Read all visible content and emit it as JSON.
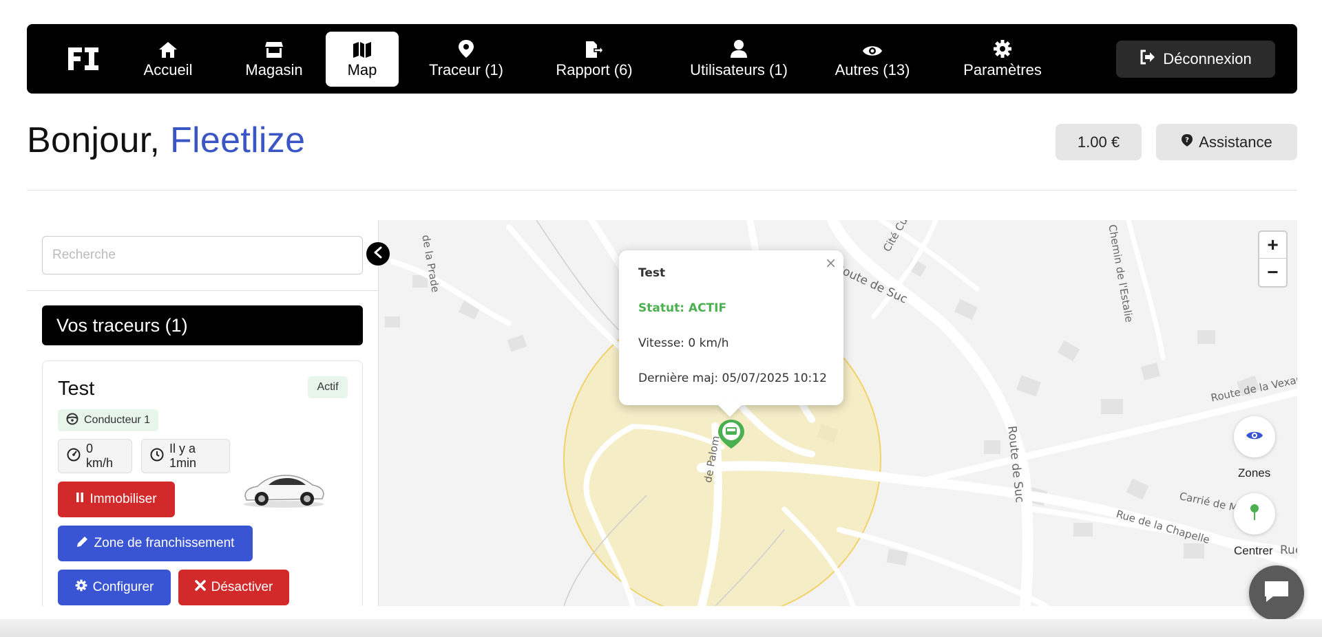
{
  "navbar": {
    "logo_text": "FI",
    "items": [
      {
        "label": "Accueil",
        "icon": "home-icon"
      },
      {
        "label": "Magasin",
        "icon": "store-icon"
      },
      {
        "label": "Map",
        "icon": "map-icon",
        "active": true
      },
      {
        "label": "Traceur (1)",
        "icon": "location-pin-icon"
      },
      {
        "label": "Rapport (6)",
        "icon": "file-export-icon"
      },
      {
        "label": "Utilisateurs (1)",
        "icon": "user-icon"
      },
      {
        "label": "Autres (13)",
        "icon": "eye-icon"
      },
      {
        "label": "Paramètres",
        "icon": "gear-icon"
      }
    ],
    "logout_label": "Déconnexion"
  },
  "header": {
    "greeting": "Bonjour,",
    "user_name": "Fleetlize",
    "balance": "1.00 €",
    "assistance_label": "Assistance"
  },
  "sidebar": {
    "search_placeholder": "Recherche",
    "section_title": "Vos traceurs (1)",
    "tracker": {
      "name": "Test",
      "status_badge": "Actif",
      "driver": "Conducteur 1",
      "speed": "0 km/h",
      "last_seen": "Il y a 1min",
      "actions": {
        "immobilize": "Immobiliser",
        "zone": "Zone de franchissement",
        "configure": "Configurer",
        "deactivate": "Désactiver"
      }
    }
  },
  "map": {
    "popup": {
      "title": "Test",
      "status": "Statut: ACTIF",
      "speed": "Vitesse: 0 km/h",
      "last_update": "Dernière maj: 05/07/2025 10:12"
    },
    "street_labels": [
      "de la Prade",
      "Cité Cuille",
      "Route de Suc",
      "Chemin de l'Estalie",
      "Route de la Vexan",
      "Route de Suc",
      "Carrié de M",
      "Rue de la Chapelle",
      "de Palom",
      "Rue"
    ],
    "controls": {
      "zoom_in": "+",
      "zoom_out": "−",
      "zones_label": "Zones",
      "center_label": "Centrer"
    },
    "colors": {
      "zone_fill": "#f7e9a8",
      "marker": "#4caf50"
    }
  },
  "colors": {
    "accent": "#3a55c4",
    "danger": "#d22a2a",
    "primary": "#3a55d4",
    "success": "#4caf50"
  }
}
